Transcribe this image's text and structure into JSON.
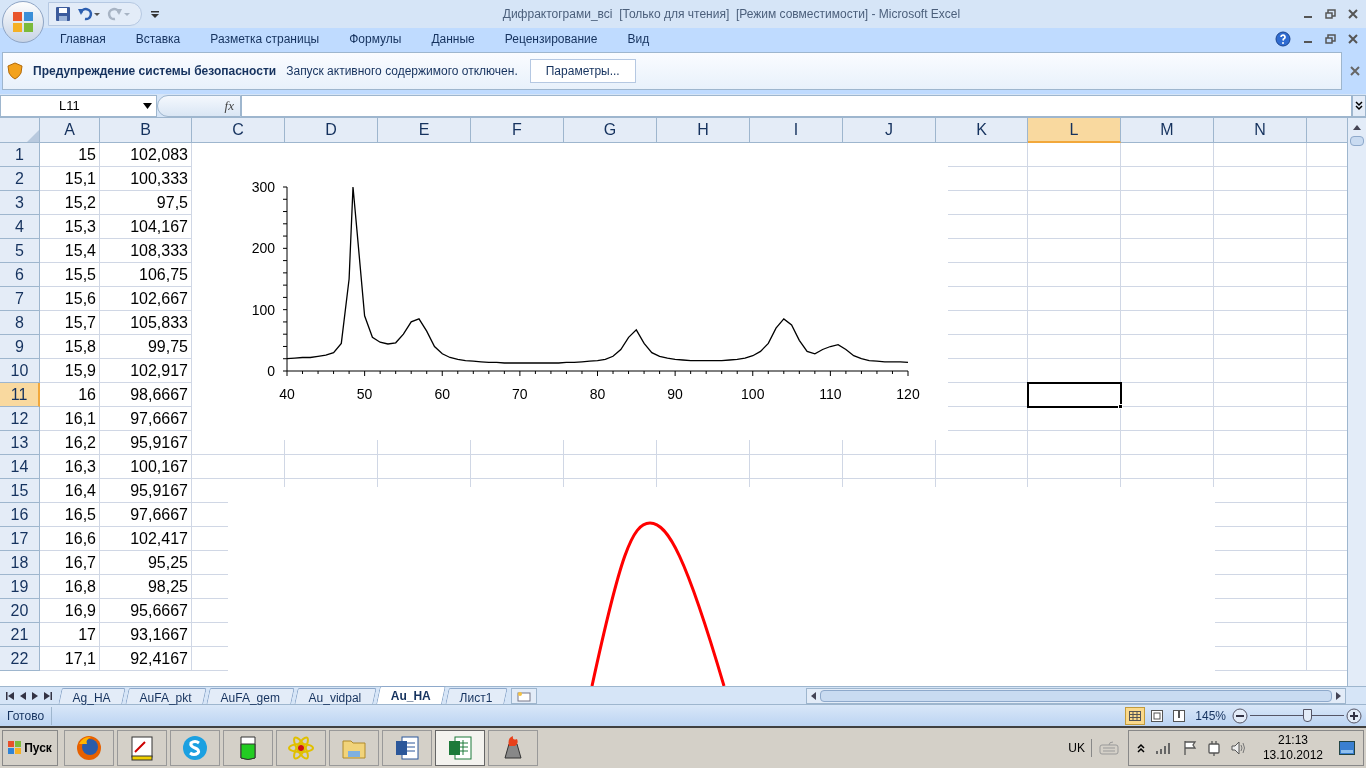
{
  "window": {
    "title": "Дифрактограми_всі  [Только для чтения]  [Режим совместимости] - Microsoft Excel"
  },
  "ribbon_tabs": [
    {
      "label": "Главная",
      "selected": false
    },
    {
      "label": "Вставка",
      "selected": false
    },
    {
      "label": "Разметка страницы",
      "selected": false
    },
    {
      "label": "Формулы",
      "selected": false
    },
    {
      "label": "Данные",
      "selected": false
    },
    {
      "label": "Рецензирование",
      "selected": false
    },
    {
      "label": "Вид",
      "selected": false
    }
  ],
  "security_bar": {
    "title": "Предупреждение системы безопасности",
    "message": "Запуск активного содержимого отключен.",
    "button": "Параметры..."
  },
  "formula_bar": {
    "name_box": "L11",
    "function_label": "fx"
  },
  "columns": [
    {
      "label": "A",
      "selected": false
    },
    {
      "label": "B",
      "selected": false
    },
    {
      "label": "C",
      "selected": false
    },
    {
      "label": "D",
      "selected": false
    },
    {
      "label": "E",
      "selected": false
    },
    {
      "label": "F",
      "selected": false
    },
    {
      "label": "G",
      "selected": false
    },
    {
      "label": "H",
      "selected": false
    },
    {
      "label": "I",
      "selected": false
    },
    {
      "label": "J",
      "selected": false
    },
    {
      "label": "K",
      "selected": false
    },
    {
      "label": "L",
      "selected": true
    },
    {
      "label": "M",
      "selected": false
    },
    {
      "label": "N",
      "selected": false
    }
  ],
  "rows": [
    {
      "number": "1",
      "a": "15",
      "b": "102,083",
      "selected": false
    },
    {
      "number": "2",
      "a": "15,1",
      "b": "100,333",
      "selected": false
    },
    {
      "number": "3",
      "a": "15,2",
      "b": "97,5",
      "selected": false
    },
    {
      "number": "4",
      "a": "15,3",
      "b": "104,167",
      "selected": false
    },
    {
      "number": "5",
      "a": "15,4",
      "b": "108,333",
      "selected": false
    },
    {
      "number": "6",
      "a": "15,5",
      "b": "106,75",
      "selected": false
    },
    {
      "number": "7",
      "a": "15,6",
      "b": "102,667",
      "selected": false
    },
    {
      "number": "8",
      "a": "15,7",
      "b": "105,833",
      "selected": false
    },
    {
      "number": "9",
      "a": "15,8",
      "b": "99,75",
      "selected": false
    },
    {
      "number": "10",
      "a": "15,9",
      "b": "102,917",
      "selected": false
    },
    {
      "number": "11",
      "a": "16",
      "b": "98,6667",
      "selected": true
    },
    {
      "number": "12",
      "a": "16,1",
      "b": "97,6667",
      "selected": false
    },
    {
      "number": "13",
      "a": "16,2",
      "b": "95,9167",
      "selected": false
    },
    {
      "number": "14",
      "a": "16,3",
      "b": "100,167",
      "selected": false
    },
    {
      "number": "15",
      "a": "16,4",
      "b": "95,9167",
      "selected": false
    },
    {
      "number": "16",
      "a": "16,5",
      "b": "97,6667",
      "selected": false
    },
    {
      "number": "17",
      "a": "16,6",
      "b": "102,417",
      "selected": false
    },
    {
      "number": "18",
      "a": "16,7",
      "b": "95,25",
      "selected": false
    },
    {
      "number": "19",
      "a": "16,8",
      "b": "98,25",
      "selected": false
    },
    {
      "number": "20",
      "a": "16,9",
      "b": "95,6667",
      "selected": false
    },
    {
      "number": "21",
      "a": "17",
      "b": "93,1667",
      "selected": false
    },
    {
      "number": "22",
      "a": "17,1",
      "b": "92,4167",
      "selected": false
    }
  ],
  "chart_data": {
    "type": "line",
    "x": [
      40,
      41,
      42,
      43,
      44,
      45,
      46,
      47,
      48,
      48.5,
      49,
      50,
      51,
      52,
      53,
      54,
      55,
      56,
      57,
      58,
      59,
      60,
      61,
      62,
      63,
      64,
      65,
      66,
      67,
      68,
      69,
      70,
      71,
      72,
      73,
      74,
      75,
      76,
      77,
      78,
      79,
      80,
      81,
      82,
      83,
      84,
      85,
      86,
      87,
      88,
      89,
      90,
      91,
      92,
      93,
      94,
      95,
      96,
      97,
      98,
      99,
      100,
      101,
      102,
      103,
      104,
      105,
      106,
      107,
      108,
      109,
      110,
      111,
      112,
      113,
      114,
      115,
      116,
      117,
      118,
      119,
      120
    ],
    "series": [
      {
        "color": "#000000",
        "values": [
          20,
          21,
          22,
          22,
          24,
          26,
          30,
          45,
          150,
          300,
          230,
          90,
          55,
          47,
          44,
          46,
          60,
          80,
          85,
          65,
          40,
          28,
          22,
          19,
          17,
          16,
          15,
          14,
          14,
          13,
          13,
          13,
          13,
          13,
          13,
          13,
          13,
          14,
          14,
          15,
          16,
          17,
          19,
          24,
          35,
          55,
          67,
          45,
          30,
          24,
          21,
          19,
          18,
          17,
          17,
          17,
          17,
          17,
          18,
          19,
          21,
          25,
          32,
          45,
          70,
          85,
          75,
          50,
          32,
          28,
          35,
          40,
          43,
          35,
          25,
          20,
          17,
          16,
          15,
          15,
          15,
          14
        ]
      }
    ],
    "xlim": [
      40,
      120
    ],
    "ylim": [
      0,
      300
    ],
    "xticks": [
      40,
      50,
      60,
      70,
      80,
      90,
      100,
      110,
      120
    ],
    "yticks": [
      0,
      100,
      200,
      300
    ]
  },
  "sheet_tabs": [
    {
      "label": "Ag_HA",
      "selected": false
    },
    {
      "label": "AuFA_pkt",
      "selected": false
    },
    {
      "label": "AuFA_gem",
      "selected": false
    },
    {
      "label": "Au_vidpal",
      "selected": false
    },
    {
      "label": "Au_HA",
      "selected": true
    },
    {
      "label": "Лист1",
      "selected": false
    }
  ],
  "status_bar": {
    "text": "Готово",
    "zoom": "145%",
    "zoom_slider": {
      "level": 0.62
    }
  },
  "taskbar": {
    "start": "Пуск",
    "apps": [
      {
        "kind": "browser",
        "selected": false
      },
      {
        "kind": "sketch",
        "selected": false
      },
      {
        "kind": "chat",
        "selected": false
      },
      {
        "kind": "beaker",
        "selected": false
      },
      {
        "kind": "atom",
        "selected": false
      },
      {
        "kind": "folder",
        "selected": false
      },
      {
        "kind": "word",
        "selected": false
      },
      {
        "kind": "excel",
        "selected": true
      },
      {
        "kind": "tool",
        "selected": false
      }
    ],
    "language": "UK",
    "time": "21:13",
    "date": "13.10.2012"
  }
}
